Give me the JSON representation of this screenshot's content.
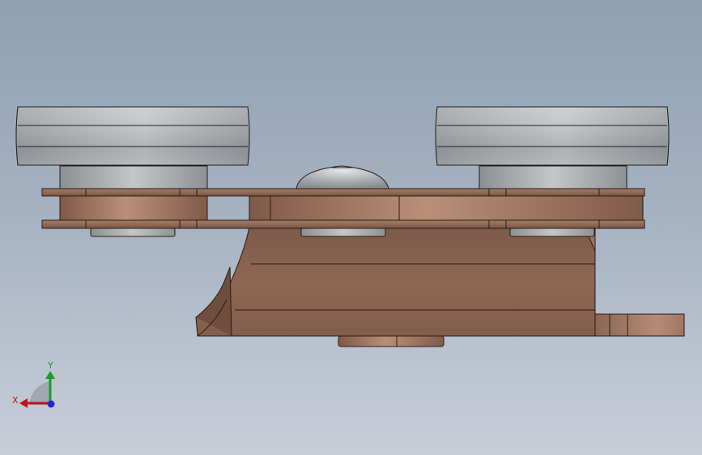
{
  "view": {
    "colors": {
      "background_top": "#8fa0b3",
      "background_bottom": "#c8ced8",
      "part_copper": "#8b6450",
      "part_copper_light": "#b08670",
      "part_steel": "#a7aaae"
    }
  },
  "triad": {
    "x_label": "X",
    "y_label": "Y",
    "x_color": "#c0141c",
    "y_color": "#1a9c2a",
    "z_color": "#1a2ad0"
  }
}
